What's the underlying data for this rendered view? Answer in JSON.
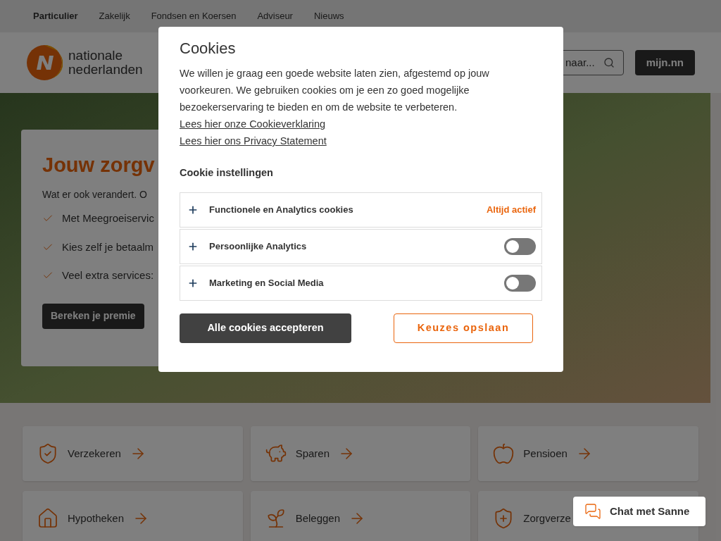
{
  "top_nav": [
    {
      "label": "Particulier",
      "selected": true
    },
    {
      "label": "Zakelijk",
      "selected": false
    },
    {
      "label": "Fondsen en Koersen",
      "selected": false
    },
    {
      "label": "Adviseur",
      "selected": false
    },
    {
      "label": "Nieuws",
      "selected": false
    }
  ],
  "logo": {
    "line_1": "nationale",
    "line_2": "nederlanden"
  },
  "search": {
    "placeholder": "naar..."
  },
  "login_button": "mijn.nn",
  "hero": {
    "title": "Jouw zorgv",
    "intro": "Wat er ook verandert. O",
    "bullets": [
      "Met Meegroeiservic",
      "Kies zelf je betaalm",
      "Veel extra services:"
    ],
    "button": "Bereken je premie"
  },
  "tiles": [
    {
      "label": "Verzekeren"
    },
    {
      "label": "Sparen"
    },
    {
      "label": "Pensioen"
    },
    {
      "label": "Hypotheken"
    },
    {
      "label": "Beleggen"
    },
    {
      "label": "Zorgverze"
    }
  ],
  "chat": {
    "label": "Chat met Sanne"
  },
  "cookie_dialog": {
    "title": "Cookies",
    "text": "We willen je graag een goede website laten zien, afgestemd op jouw voorkeuren. We gebruiken cookies om je een zo goed mogelijke bezoekerservaring te bieden en om de website te verbeteren.",
    "links": [
      "Lees hier onze Cookieverklaring",
      "Lees hier ons Privacy Statement"
    ],
    "settings_title": "Cookie instellingen",
    "categories": [
      {
        "kind": "always",
        "label": "Functionele en Analytics cookies",
        "status": "Altijd actief",
        "expanded": false
      },
      {
        "kind": "toggle",
        "label": "Persoonlijke Analytics",
        "on": false,
        "expanded": false
      },
      {
        "kind": "toggle",
        "label": "Marketing en Social Media",
        "on": false,
        "expanded": false
      }
    ],
    "accept_button": "Alle cookies accepteren",
    "save_button": "Keuzes opslaan"
  }
}
